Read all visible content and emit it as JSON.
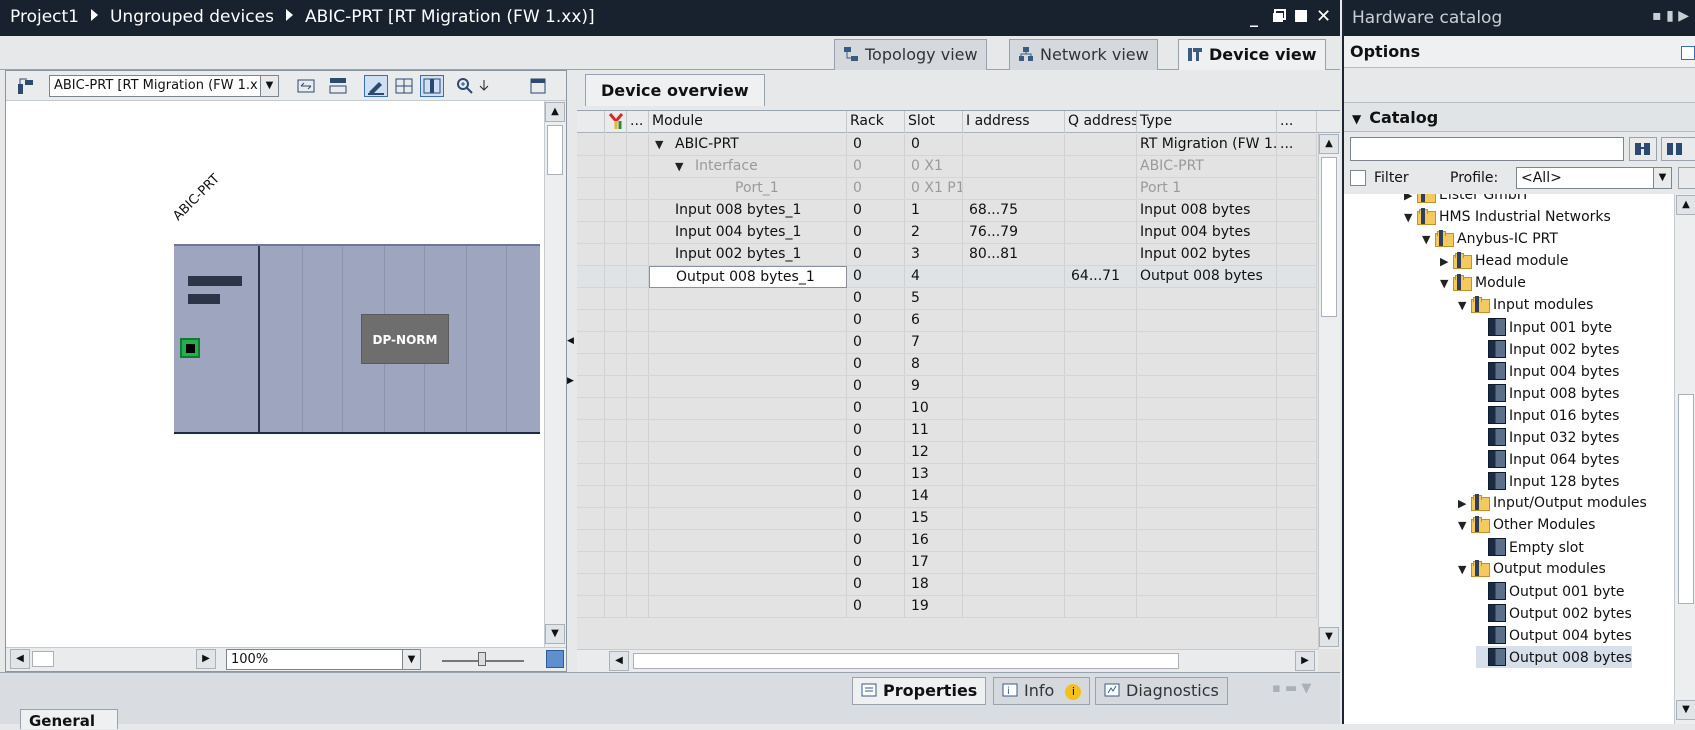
{
  "titlebar": {
    "crumbs": [
      "Project1",
      "Ungrouped devices",
      "ABIC-PRT [RT Migration (FW 1.xx)]"
    ],
    "buttons": [
      "_",
      "▪",
      "▪",
      "✕"
    ]
  },
  "view_tabs": [
    {
      "label": "Topology view",
      "active": false
    },
    {
      "label": "Network view",
      "active": false
    },
    {
      "label": "Device view",
      "active": true
    }
  ],
  "graphic": {
    "device_select": "ABIC-PRT [RT Migration (FW 1.x",
    "device_label": "ABIC-PRT",
    "module_label": "DP-NORM",
    "zoom": "100%"
  },
  "overview": {
    "tab_label": "Device overview",
    "columns": [
      "...",
      "Module",
      "Rack",
      "Slot",
      "I address",
      "Q address",
      "Type",
      "..."
    ],
    "rows": [
      {
        "module": "ABIC-PRT",
        "rack": "0",
        "slot": "0",
        "i": "",
        "q": "",
        "type": "RT Migration (FW 1....",
        "extra": "...",
        "indent": 0,
        "tri": "▼",
        "grey": false,
        "sel": false
      },
      {
        "module": "Interface",
        "rack": "0",
        "slot": "0 X1",
        "i": "",
        "q": "",
        "type": "ABIC-PRT",
        "extra": "",
        "indent": 1,
        "tri": "▼",
        "grey": true,
        "sel": false
      },
      {
        "module": "Port_1",
        "rack": "0",
        "slot": "0 X1 P1",
        "i": "",
        "q": "",
        "type": "Port 1",
        "extra": "",
        "indent": 2,
        "tri": "",
        "grey": true,
        "sel": false
      },
      {
        "module": "Input 008 bytes_1",
        "rack": "0",
        "slot": "1",
        "i": "68...75",
        "q": "",
        "type": "Input 008 bytes",
        "extra": "",
        "indent": 0,
        "tri": "",
        "grey": false,
        "sel": false
      },
      {
        "module": "Input 004 bytes_1",
        "rack": "0",
        "slot": "2",
        "i": "76...79",
        "q": "",
        "type": "Input 004 bytes",
        "extra": "",
        "indent": 0,
        "tri": "",
        "grey": false,
        "sel": false
      },
      {
        "module": "Input 002 bytes_1",
        "rack": "0",
        "slot": "3",
        "i": "80...81",
        "q": "",
        "type": "Input 002 bytes",
        "extra": "",
        "indent": 0,
        "tri": "",
        "grey": false,
        "sel": false
      },
      {
        "module": "Output 008 bytes_1",
        "rack": "0",
        "slot": "4",
        "i": "",
        "q": "64...71",
        "type": "Output 008 bytes",
        "extra": "",
        "indent": 0,
        "tri": "",
        "grey": false,
        "sel": true
      },
      {
        "module": "",
        "rack": "0",
        "slot": "5",
        "i": "",
        "q": "",
        "type": "",
        "extra": "",
        "indent": 0,
        "tri": "",
        "grey": false,
        "sel": false
      },
      {
        "module": "",
        "rack": "0",
        "slot": "6",
        "i": "",
        "q": "",
        "type": "",
        "extra": "",
        "indent": 0,
        "tri": "",
        "grey": false,
        "sel": false
      },
      {
        "module": "",
        "rack": "0",
        "slot": "7",
        "i": "",
        "q": "",
        "type": "",
        "extra": "",
        "indent": 0,
        "tri": "",
        "grey": false,
        "sel": false
      },
      {
        "module": "",
        "rack": "0",
        "slot": "8",
        "i": "",
        "q": "",
        "type": "",
        "extra": "",
        "indent": 0,
        "tri": "",
        "grey": false,
        "sel": false
      },
      {
        "module": "",
        "rack": "0",
        "slot": "9",
        "i": "",
        "q": "",
        "type": "",
        "extra": "",
        "indent": 0,
        "tri": "",
        "grey": false,
        "sel": false
      },
      {
        "module": "",
        "rack": "0",
        "slot": "10",
        "i": "",
        "q": "",
        "type": "",
        "extra": "",
        "indent": 0,
        "tri": "",
        "grey": false,
        "sel": false
      },
      {
        "module": "",
        "rack": "0",
        "slot": "11",
        "i": "",
        "q": "",
        "type": "",
        "extra": "",
        "indent": 0,
        "tri": "",
        "grey": false,
        "sel": false
      },
      {
        "module": "",
        "rack": "0",
        "slot": "12",
        "i": "",
        "q": "",
        "type": "",
        "extra": "",
        "indent": 0,
        "tri": "",
        "grey": false,
        "sel": false
      },
      {
        "module": "",
        "rack": "0",
        "slot": "13",
        "i": "",
        "q": "",
        "type": "",
        "extra": "",
        "indent": 0,
        "tri": "",
        "grey": false,
        "sel": false
      },
      {
        "module": "",
        "rack": "0",
        "slot": "14",
        "i": "",
        "q": "",
        "type": "",
        "extra": "",
        "indent": 0,
        "tri": "",
        "grey": false,
        "sel": false
      },
      {
        "module": "",
        "rack": "0",
        "slot": "15",
        "i": "",
        "q": "",
        "type": "",
        "extra": "",
        "indent": 0,
        "tri": "",
        "grey": false,
        "sel": false
      },
      {
        "module": "",
        "rack": "0",
        "slot": "16",
        "i": "",
        "q": "",
        "type": "",
        "extra": "",
        "indent": 0,
        "tri": "",
        "grey": false,
        "sel": false
      },
      {
        "module": "",
        "rack": "0",
        "slot": "17",
        "i": "",
        "q": "",
        "type": "",
        "extra": "",
        "indent": 0,
        "tri": "",
        "grey": false,
        "sel": false
      },
      {
        "module": "",
        "rack": "0",
        "slot": "18",
        "i": "",
        "q": "",
        "type": "",
        "extra": "",
        "indent": 0,
        "tri": "",
        "grey": false,
        "sel": false
      },
      {
        "module": "",
        "rack": "0",
        "slot": "19",
        "i": "",
        "q": "",
        "type": "",
        "extra": "",
        "indent": 0,
        "tri": "",
        "grey": false,
        "sel": false
      }
    ]
  },
  "bottom": {
    "tabs": [
      {
        "label": "Properties",
        "active": true
      },
      {
        "label": "Info",
        "active": false
      },
      {
        "label": "Diagnostics",
        "active": false
      }
    ],
    "general_tab": "General"
  },
  "catalog": {
    "title": "Hardware catalog",
    "options_label": "Options",
    "catalog_label": "Catalog",
    "filter_label": "Filter",
    "profile_label": "Profile:",
    "profile_value": "<All>",
    "tree": [
      {
        "label": "Elster GmbH",
        "level": 0,
        "tri": "▶",
        "icon": "folder",
        "sel": false
      },
      {
        "label": "HMS Industrial Networks",
        "level": 0,
        "tri": "▼",
        "icon": "folder",
        "sel": false
      },
      {
        "label": "Anybus-IC PRT",
        "level": 1,
        "tri": "▼",
        "icon": "folder",
        "sel": false
      },
      {
        "label": "Head module",
        "level": 2,
        "tri": "▶",
        "icon": "folder",
        "sel": false
      },
      {
        "label": "Module",
        "level": 2,
        "tri": "▼",
        "icon": "folder",
        "sel": false
      },
      {
        "label": "Input modules",
        "level": 3,
        "tri": "▼",
        "icon": "folder",
        "sel": false
      },
      {
        "label": "Input 001 byte",
        "level": 4,
        "tri": "",
        "icon": "module",
        "sel": false
      },
      {
        "label": "Input 002 bytes",
        "level": 4,
        "tri": "",
        "icon": "module",
        "sel": false
      },
      {
        "label": "Input 004 bytes",
        "level": 4,
        "tri": "",
        "icon": "module",
        "sel": false
      },
      {
        "label": "Input 008 bytes",
        "level": 4,
        "tri": "",
        "icon": "module",
        "sel": false
      },
      {
        "label": "Input 016 bytes",
        "level": 4,
        "tri": "",
        "icon": "module",
        "sel": false
      },
      {
        "label": "Input 032 bytes",
        "level": 4,
        "tri": "",
        "icon": "module",
        "sel": false
      },
      {
        "label": "Input 064 bytes",
        "level": 4,
        "tri": "",
        "icon": "module",
        "sel": false
      },
      {
        "label": "Input 128 bytes",
        "level": 4,
        "tri": "",
        "icon": "module",
        "sel": false
      },
      {
        "label": "Input/Output modules",
        "level": 3,
        "tri": "▶",
        "icon": "folder",
        "sel": false
      },
      {
        "label": "Other Modules",
        "level": 3,
        "tri": "▼",
        "icon": "folder",
        "sel": false
      },
      {
        "label": "Empty slot",
        "level": 4,
        "tri": "",
        "icon": "module",
        "sel": false
      },
      {
        "label": "Output modules",
        "level": 3,
        "tri": "▼",
        "icon": "folder",
        "sel": false
      },
      {
        "label": "Output 001 byte",
        "level": 4,
        "tri": "",
        "icon": "module",
        "sel": false
      },
      {
        "label": "Output 002 bytes",
        "level": 4,
        "tri": "",
        "icon": "module",
        "sel": false
      },
      {
        "label": "Output 004 bytes",
        "level": 4,
        "tri": "",
        "icon": "module",
        "sel": false
      },
      {
        "label": "Output 008 bytes",
        "level": 4,
        "tri": "",
        "icon": "module",
        "sel": true
      }
    ]
  },
  "colors": {
    "titlebar": "#18222e",
    "rack": "#9ea5bf",
    "accent": "#3a6fb0"
  }
}
